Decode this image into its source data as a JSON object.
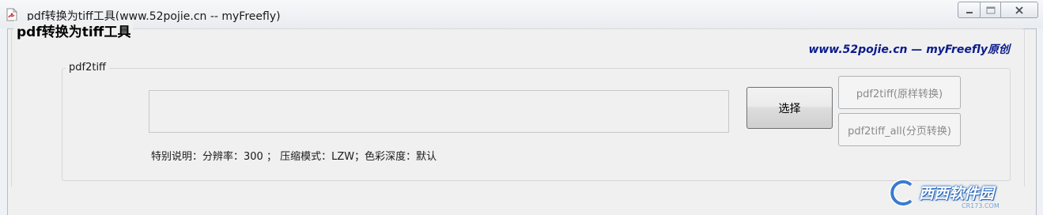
{
  "window": {
    "title": "pdf转换为tiff工具(www.52pojie.cn -- myFreefly)"
  },
  "main_group": {
    "title": "pdf转换为tiff工具"
  },
  "credit": "www.52pojie.cn — myFreefly原创",
  "inner_group": {
    "title": "pdf2tiff"
  },
  "path_input": {
    "value": "",
    "placeholder": ""
  },
  "buttons": {
    "select": "选择",
    "pdf2tiff": "pdf2tiff(原样转换)",
    "pdf2tiff_all": "pdf2tiff_all(分页转换)"
  },
  "note": "特别说明：分辨率：300 ； 压缩模式：LZW；色彩深度：默认",
  "watermark": {
    "text": "西西软件园",
    "sub": "CR173.COM"
  },
  "icons": {
    "app": "pdf-file-icon",
    "minimize": "minimize-icon",
    "maximize": "maximize-icon",
    "close": "close-icon"
  },
  "colors": {
    "credit": "#0b1c8a",
    "disabled_text": "#8a8a8a",
    "accent": "#2f6fc0"
  }
}
